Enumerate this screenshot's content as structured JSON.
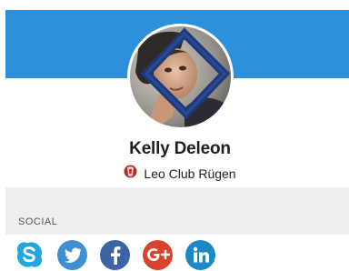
{
  "profile": {
    "name": "Kelly Deleon",
    "club_name": "Leo Club Rügen"
  },
  "sections": {
    "social_title": "SOCIAL"
  },
  "social_links": [
    {
      "icon": "skype-icon",
      "color": "#1ea7e2"
    },
    {
      "icon": "twitter-icon",
      "color": "#3f8fd1"
    },
    {
      "icon": "facebook-icon",
      "color": "#3b63a6"
    },
    {
      "icon": "google-plus-icon",
      "color": "#d8432d"
    },
    {
      "icon": "linkedin-icon",
      "color": "#1c88c4"
    }
  ],
  "colors": {
    "banner": "#2d90dc",
    "section_background": "#eeeeee",
    "club_icon": "#b92a2a"
  }
}
